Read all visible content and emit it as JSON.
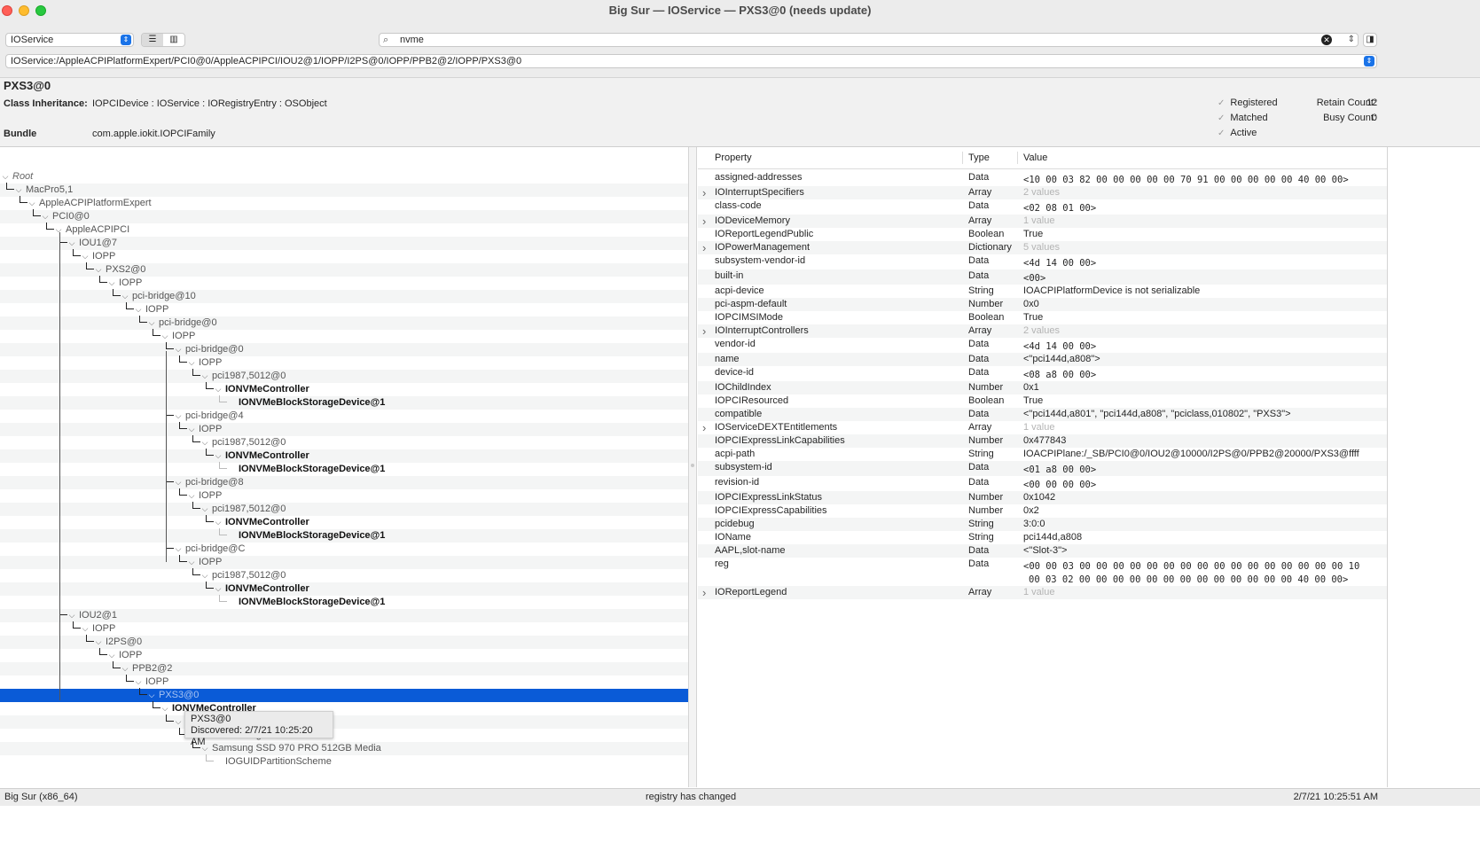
{
  "window": {
    "title": "Big Sur — IOService — PXS3@0 (needs update)"
  },
  "toolbar": {
    "plane": "IOService",
    "search_value": "nvme",
    "path": "IOService:/AppleACPIPlatformExpert/PCI0@0/AppleACPIPCI/IOU2@1/IOPP/I2PS@0/IOPP/PPB2@2/IOPP/PXS3@0"
  },
  "info": {
    "name": "PXS3@0",
    "class_inheritance_label": "Class Inheritance:",
    "class_inheritance": "IOPCIDevice : IOService : IORegistryEntry : OSObject",
    "bundle_label": "Bundle",
    "bundle": "com.apple.iokit.IOPCIFamily",
    "flags": [
      "Registered",
      "Matched",
      "Active"
    ],
    "retain_count_label": "Retain Count:",
    "retain_count": "12",
    "busy_count_label": "Busy Count:",
    "busy_count": "0"
  },
  "tree": [
    {
      "label": "Root",
      "style": "italic"
    },
    {
      "label": "MacPro5,1"
    },
    {
      "label": "AppleACPIPlatformExpert"
    },
    {
      "label": "PCI0@0"
    },
    {
      "label": "AppleACPIPCI"
    },
    {
      "label": "IOU1@7"
    },
    {
      "label": "IOPP"
    },
    {
      "label": "PXS2@0"
    },
    {
      "label": "IOPP"
    },
    {
      "label": "pci-bridge@10"
    },
    {
      "label": "IOPP"
    },
    {
      "label": "pci-bridge@0"
    },
    {
      "label": "IOPP"
    },
    {
      "label": "pci-bridge@0"
    },
    {
      "label": "IOPP"
    },
    {
      "label": "pci1987,5012@0"
    },
    {
      "label": "IONVMeController",
      "style": "bold"
    },
    {
      "label": "IONVMeBlockStorageDevice@1",
      "style": "bold"
    },
    {
      "label": "pci-bridge@4"
    },
    {
      "label": "IOPP"
    },
    {
      "label": "pci1987,5012@0"
    },
    {
      "label": "IONVMeController",
      "style": "bold"
    },
    {
      "label": "IONVMeBlockStorageDevice@1",
      "style": "bold"
    },
    {
      "label": "pci-bridge@8"
    },
    {
      "label": "IOPP"
    },
    {
      "label": "pci1987,5012@0"
    },
    {
      "label": "IONVMeController",
      "style": "bold"
    },
    {
      "label": "IONVMeBlockStorageDevice@1",
      "style": "bold"
    },
    {
      "label": "pci-bridge@C"
    },
    {
      "label": "IOPP"
    },
    {
      "label": "pci1987,5012@0"
    },
    {
      "label": "IONVMeController",
      "style": "bold"
    },
    {
      "label": "IONVMeBlockStorageDevice@1",
      "style": "bold"
    },
    {
      "label": "IOU2@1"
    },
    {
      "label": "IOPP"
    },
    {
      "label": "I2PS@0"
    },
    {
      "label": "IOPP"
    },
    {
      "label": "PPB2@2"
    },
    {
      "label": "IOPP"
    },
    {
      "label": "PXS3@0",
      "style": "selected"
    },
    {
      "label": "IONVMeController",
      "style": "bold"
    },
    {
      "label": "IONVMeBlockStorageDevice@1",
      "style": "bold"
    },
    {
      "label": "IOBlockStorageDriver"
    },
    {
      "label": "Samsung SSD 970 PRO 512GB Media"
    },
    {
      "label": "IOGUIDPartitionScheme"
    }
  ],
  "tooltip": {
    "title": "PXS3@0",
    "discovered": "Discovered: 2/7/21 10:25:20 AM"
  },
  "properties": {
    "headers": [
      "Property",
      "Type",
      "Value"
    ],
    "rows": [
      {
        "key": "assigned-addresses",
        "type": "Data",
        "value": "<10 00 03 82 00 00 00 00 00 70 91 00 00 00 00 00 40 00 00>",
        "mono": true
      },
      {
        "key": "IOInterruptSpecifiers",
        "type": "Array",
        "value": "2 values",
        "dim": true,
        "expandable": true
      },
      {
        "key": "class-code",
        "type": "Data",
        "value": "<02 08 01 00>",
        "mono": true
      },
      {
        "key": "IODeviceMemory",
        "type": "Array",
        "value": "1 value",
        "dim": true,
        "expandable": true
      },
      {
        "key": "IOReportLegendPublic",
        "type": "Boolean",
        "value": "True"
      },
      {
        "key": "IOPowerManagement",
        "type": "Dictionary",
        "value": "5 values",
        "dim": true,
        "expandable": true
      },
      {
        "key": "subsystem-vendor-id",
        "type": "Data",
        "value": "<4d 14 00 00>",
        "mono": true
      },
      {
        "key": "built-in",
        "type": "Data",
        "value": "<00>",
        "mono": true
      },
      {
        "key": "acpi-device",
        "type": "String",
        "value": "IOACPIPlatformDevice is not serializable"
      },
      {
        "key": "pci-aspm-default",
        "type": "Number",
        "value": "0x0"
      },
      {
        "key": "IOPCIMSIMode",
        "type": "Boolean",
        "value": "True"
      },
      {
        "key": "IOInterruptControllers",
        "type": "Array",
        "value": "2 values",
        "dim": true,
        "expandable": true
      },
      {
        "key": "vendor-id",
        "type": "Data",
        "value": "<4d 14 00 00>",
        "mono": true
      },
      {
        "key": "name",
        "type": "Data",
        "value": "<\"pci144d,a808\">"
      },
      {
        "key": "device-id",
        "type": "Data",
        "value": "<08 a8 00 00>",
        "mono": true
      },
      {
        "key": "IOChildIndex",
        "type": "Number",
        "value": "0x1"
      },
      {
        "key": "IOPCIResourced",
        "type": "Boolean",
        "value": "True"
      },
      {
        "key": "compatible",
        "type": "Data",
        "value": "<\"pci144d,a801\", \"pci144d,a808\", \"pciclass,010802\", \"PXS3\">"
      },
      {
        "key": "IOServiceDEXTEntitlements",
        "type": "Array",
        "value": "1 value",
        "dim": true,
        "expandable": true
      },
      {
        "key": "IOPCIExpressLinkCapabilities",
        "type": "Number",
        "value": "0x477843"
      },
      {
        "key": "acpi-path",
        "type": "String",
        "value": "IOACPIPlane:/_SB/PCI0@0/IOU2@10000/I2PS@0/PPB2@20000/PXS3@ffff"
      },
      {
        "key": "subsystem-id",
        "type": "Data",
        "value": "<01 a8 00 00>",
        "mono": true
      },
      {
        "key": "revision-id",
        "type": "Data",
        "value": "<00 00 00 00>",
        "mono": true
      },
      {
        "key": "IOPCIExpressLinkStatus",
        "type": "Number",
        "value": "0x1042"
      },
      {
        "key": "IOPCIExpressCapabilities",
        "type": "Number",
        "value": "0x2"
      },
      {
        "key": "pcidebug",
        "type": "String",
        "value": "3:0:0"
      },
      {
        "key": "IOName",
        "type": "String",
        "value": "pci144d,a808"
      },
      {
        "key": "AAPL,slot-name",
        "type": "Data",
        "value": "<\"Slot-3\">"
      },
      {
        "key": "reg",
        "type": "Data",
        "value": "<00 00 03 00 00 00 00 00 00 00 00 00 00 00 00 00 00 00 00 10",
        "value2": "00 03 02 00 00 00 00 00 00 00 00 00 00 00 00 00 40 00 00>",
        "mono": true
      },
      {
        "key": "IOReportLegend",
        "type": "Array",
        "value": "1 value",
        "dim": true,
        "expandable": true
      }
    ]
  },
  "status": {
    "left": "Big Sur (x86_64)",
    "center": "registry has changed",
    "right": "2/7/21 10:25:51 AM"
  },
  "colors": {
    "selection": "#0a5bd7",
    "accent": "#1a73e8"
  }
}
